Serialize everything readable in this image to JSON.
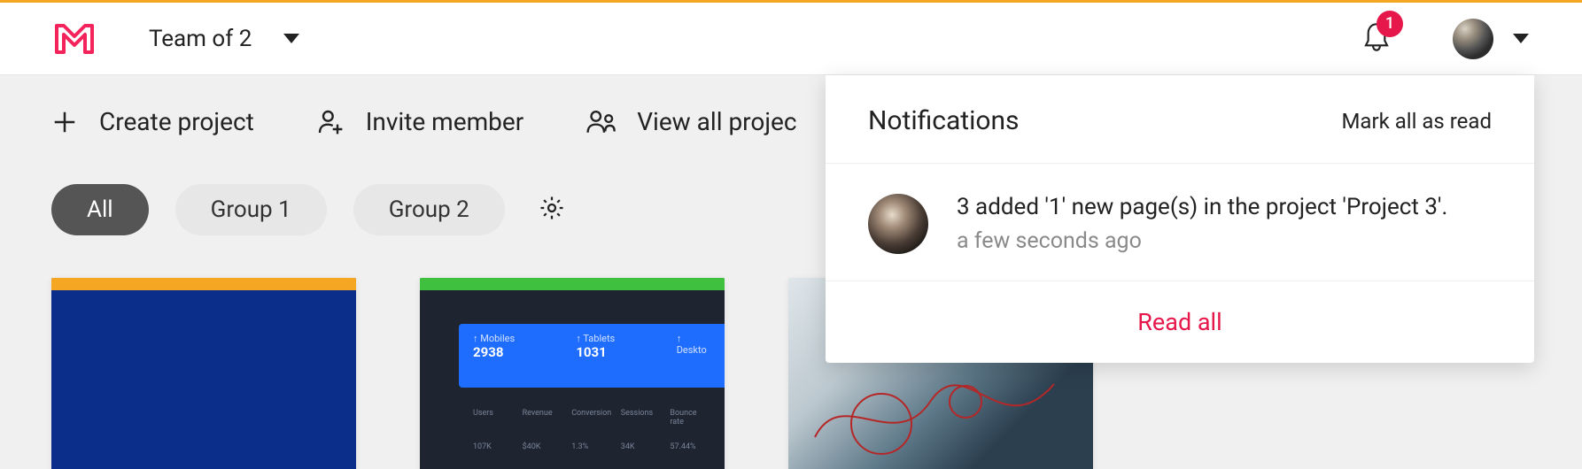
{
  "header": {
    "team_label": "Team of 2",
    "notification_count": "1"
  },
  "actions": {
    "create_project": "Create project",
    "invite_member": "Invite member",
    "view_all": "View all projec"
  },
  "filters": {
    "all": "All",
    "group1": "Group 1",
    "group2": "Group 2"
  },
  "card2": {
    "mobiles_label": "Mobiles",
    "mobiles_value": "2938",
    "tablets_label": "Tablets",
    "tablets_value": "1031",
    "desktop_label": "Deskto",
    "row_labels": [
      "Users",
      "Revenue",
      "Conversion",
      "Sessions",
      "Bounce rate"
    ],
    "row_values": [
      "107K",
      "$40K",
      "1.3%",
      "34K",
      "57.44%"
    ]
  },
  "notifications": {
    "title": "Notifications",
    "mark_all": "Mark all as read",
    "items": [
      {
        "text": "3 added '1' new page(s) in the project 'Project 3'.",
        "time": "a few seconds ago"
      }
    ],
    "read_all": "Read all"
  }
}
